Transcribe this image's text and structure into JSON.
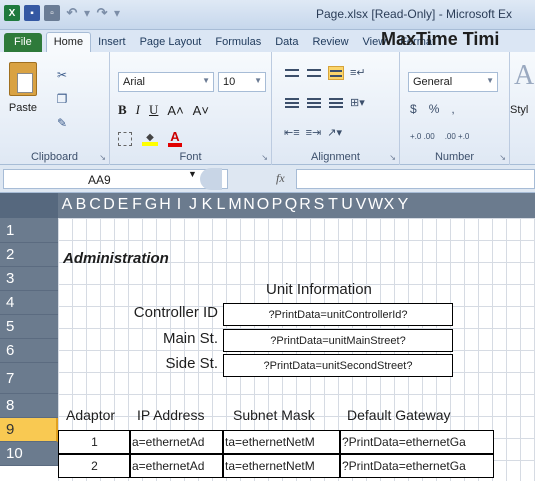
{
  "window": {
    "title": "Page.xlsx [Read-Only] - Microsoft Ex"
  },
  "ribbon": {
    "tabs": [
      "File",
      "Home",
      "Insert",
      "Page Layout",
      "Formulas",
      "Data",
      "Review",
      "View",
      "Format"
    ],
    "active_tab": "Home",
    "clipboard": {
      "paste_label": "Paste",
      "group_label": "Clipboard"
    },
    "font": {
      "name": "Arial",
      "size": "10",
      "group_label": "Font"
    },
    "alignment": {
      "group_label": "Alignment"
    },
    "number": {
      "format": "General",
      "currency": "$",
      "percent": "%",
      "comma": ",",
      "inc_decimal": "+.0 .00",
      "dec_decimal": ".00 +.0",
      "group_label": "Number"
    },
    "styles": {
      "label": "Styl",
      "icon_letter": "A"
    }
  },
  "formula_bar": {
    "name_box": "AA9",
    "fx": "fx",
    "value": ""
  },
  "sheet": {
    "columns": [
      "A",
      "B",
      "C",
      "D",
      "E",
      "F",
      "G",
      "H",
      "I",
      "J",
      "K",
      "L",
      "M",
      "N",
      "O",
      "P",
      "Q",
      "R",
      "S",
      "T",
      "U",
      "V",
      "W",
      "X",
      "Y"
    ],
    "rows": [
      "1",
      "2",
      "3",
      "4",
      "5",
      "6",
      "7",
      "8",
      "9",
      "10"
    ],
    "selected_row": "9",
    "title": "MaxTime Timi",
    "section": "Administration",
    "unit_info_heading": "Unit Information",
    "unit_fields": [
      {
        "label": "Controller ID",
        "value": "?PrintData=unitControllerId?"
      },
      {
        "label": "Main St.",
        "value": "?PrintData=unitMainStreet?"
      },
      {
        "label": "Side St.",
        "value": "?PrintData=unitSecondStreet?"
      }
    ],
    "table_headers": [
      "Adaptor",
      "IP Address",
      "Subnet Mask",
      "Default Gateway"
    ],
    "table_rows": [
      [
        "1",
        "a=ethernetAd",
        "ta=ethernetNetM",
        "?PrintData=ethernetGa"
      ],
      [
        "2",
        "a=ethernetAd",
        "ta=ethernetNetM",
        "?PrintData=ethernetGa"
      ]
    ]
  },
  "colors": {
    "accent": "#2e7a3a",
    "row_selected": "#f9c952",
    "header_bg": "#6b7b8e"
  }
}
